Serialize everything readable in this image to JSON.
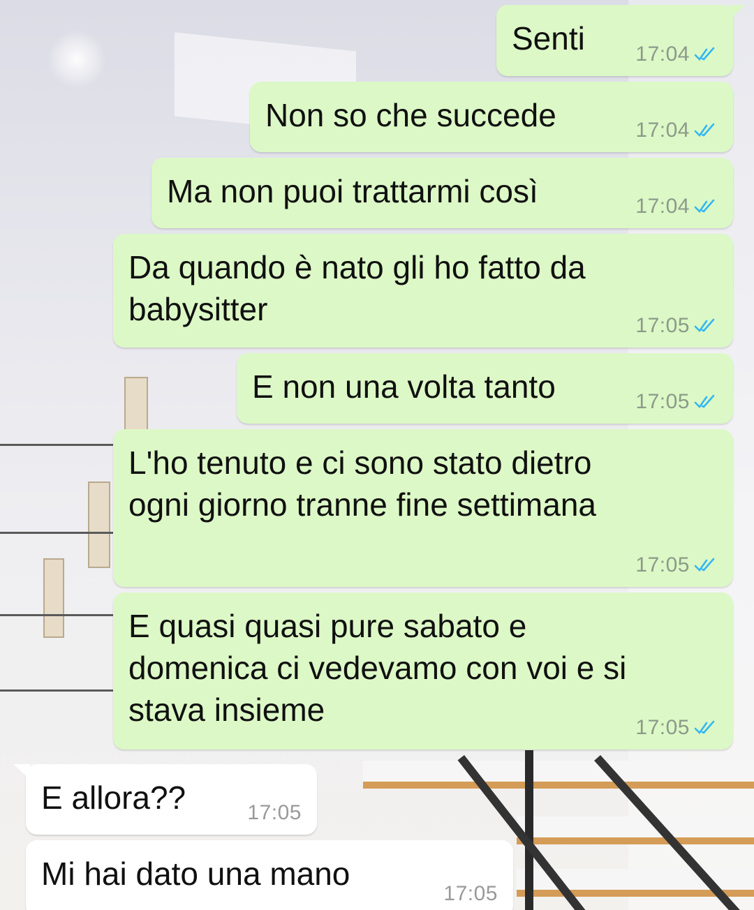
{
  "messages": [
    {
      "text": "Senti",
      "time": "17:04",
      "direction": "out",
      "status_icon": "double-check-read-icon"
    },
    {
      "text": "Non so che succede",
      "time": "17:04",
      "direction": "out",
      "status_icon": "double-check-read-icon"
    },
    {
      "text": "Ma non puoi trattarmi così",
      "time": "17:04",
      "direction": "out",
      "status_icon": "double-check-read-icon"
    },
    {
      "text": "Da quando è nato gli ho fatto da\nbabysitter",
      "time": "17:05",
      "direction": "out",
      "status_icon": "double-check-read-icon"
    },
    {
      "text": "E non una volta tanto",
      "time": "17:05",
      "direction": "out",
      "status_icon": "double-check-read-icon"
    },
    {
      "text": "L'ho tenuto e ci sono stato dietro\nogni giorno tranne fine settimana",
      "time": "17:05",
      "direction": "out",
      "status_icon": "double-check-read-icon"
    },
    {
      "text": "E quasi quasi pure sabato e\ndomenica ci vedevamo con voi e si\nstava insieme",
      "time": "17:05",
      "direction": "out",
      "status_icon": "double-check-read-icon"
    },
    {
      "text": "E allora??",
      "time": "17:05",
      "direction": "in"
    },
    {
      "text": "Mi hai dato una mano",
      "time": "17:05",
      "direction": "in"
    }
  ],
  "colors": {
    "outgoing_bubble": "#dcf8c6",
    "incoming_bubble": "#ffffff",
    "read_tick": "#34b7f1"
  }
}
